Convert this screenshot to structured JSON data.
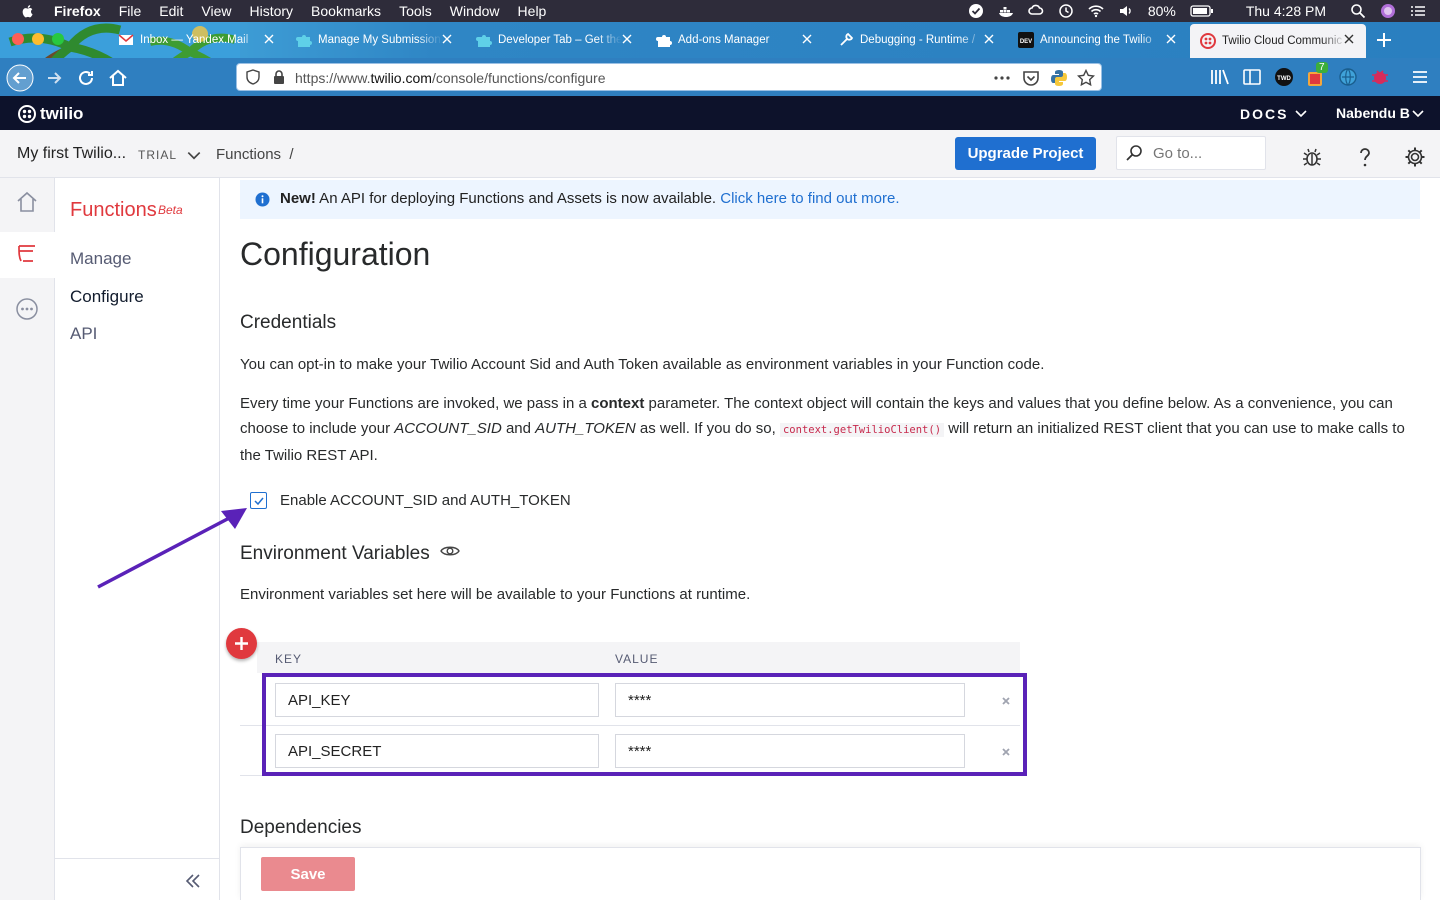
{
  "macos": {
    "app_name": "Firefox",
    "menus": [
      "File",
      "Edit",
      "View",
      "History",
      "Bookmarks",
      "Tools",
      "Window",
      "Help"
    ],
    "battery": "80%",
    "clock": "Thu 4:28 PM"
  },
  "browser": {
    "tabs": [
      {
        "label": "Inbox — Yandex.Mail",
        "icon": "mail-icon"
      },
      {
        "label": "Manage My Submissions",
        "icon": "puzzle-icon"
      },
      {
        "label": "Developer Tab – Get the",
        "icon": "puzzle-icon"
      },
      {
        "label": "Add-ons Manager",
        "icon": "puzzle-icon"
      },
      {
        "label": "Debugging - Runtime /",
        "icon": "wrench-icon"
      },
      {
        "label": "Announcing the Twilio",
        "icon": "dev-icon"
      },
      {
        "label": "Twilio Cloud Communic",
        "icon": "twilio-icon",
        "active": true
      }
    ],
    "url_prefix": "https://www.",
    "url_domain": "twilio.com",
    "url_path": "/console/functions/configure",
    "ext_badge": "7"
  },
  "twilio_header": {
    "logo": "twilio",
    "docs_label": "DOCS",
    "user_label": "Nabendu B"
  },
  "subheader": {
    "project": "My first Twilio...",
    "trial": "TRIAL",
    "breadcrumb": "Functions",
    "breadcrumb_sep": "/",
    "upgrade_label": "Upgrade Project",
    "goto_placeholder": "Go to..."
  },
  "sidenav": {
    "title": "Functions",
    "beta": "Beta",
    "items": [
      "Manage",
      "Configure",
      "API"
    ],
    "selected": "Configure"
  },
  "banner": {
    "new_label": "New!",
    "text": " An API for deploying Functions and Assets is now available. ",
    "link": "Click here to find out more."
  },
  "page": {
    "title": "Configuration",
    "credentials_heading": "Credentials",
    "credentials_p1": "You can opt-in to make your Twilio Account Sid and Auth Token available as environment variables in your Function code.",
    "p2_a": "Every time your Functions are invoked, we pass in a ",
    "p2_b": "context",
    "p2_c": " parameter. The context object will contain the keys and values that you define below. As a convenience, you can choose to include your ",
    "p2_d": "ACCOUNT_SID",
    "p2_e": " and ",
    "p2_f": "AUTH_TOKEN",
    "p2_g": " as well. If you do so, ",
    "p2_code": "context.getTwilioClient()",
    "p2_h": " will return an initialized REST client that you can use to make calls to the Twilio REST API.",
    "checkbox_label": "Enable ACCOUNT_SID and AUTH_TOKEN",
    "env_heading": "Environment Variables",
    "env_desc": "Environment variables set here will be available to your Functions at runtime.",
    "col_key": "KEY",
    "col_value": "VALUE",
    "env_rows": [
      {
        "key": "API_KEY",
        "value": "****"
      },
      {
        "key": "API_SECRET",
        "value": "****"
      }
    ],
    "deps_heading": "Dependencies",
    "save_label": "Save"
  },
  "colors": {
    "twilio_red": "#e0393e",
    "primary_blue": "#1f6fd0",
    "annotation_purple": "#5a22b8"
  }
}
